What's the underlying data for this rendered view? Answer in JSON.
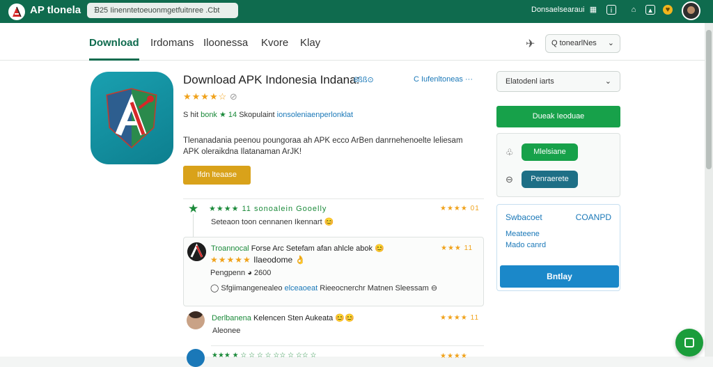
{
  "topbar": {
    "brand": "AP tlonela",
    "url": "ᗿ25 Iinenntetoeuonmgetfuitnree .Cbt",
    "user": "Donsaelsearaui",
    "icons": [
      "grid-icon",
      "info-icon",
      "home-icon",
      "image-icon",
      "coin-icon"
    ]
  },
  "nav": {
    "tabs": [
      "Download",
      "Irdomans",
      "Iloonessa",
      "Kvore",
      "Klay"
    ],
    "active_tab": "Download",
    "search_label": "Q tonearlNes"
  },
  "app": {
    "title": "Download APK Indonesia Indana:",
    "title_tag": "6ßß⊙",
    "title_action": "C Iufenltoneas ···",
    "rating_stars": "★★★★☆",
    "rating_extra": "⊘",
    "meta_prefix": "S hit",
    "meta_green": "bonk ★ 14",
    "meta_mid": "Skopulaint",
    "meta_blue": "ionsoleniaenperlonklat",
    "description": "Tlenanadania peenou poungoraa ah APK ecco ArBen danrnehenoelte leliesam APK oleraikdna Ilatanaman ArJK!",
    "button": "Ifdn lteaase"
  },
  "reviews": [
    {
      "head": "★★★★ 11 sonoalein Gooelly",
      "text": "Seteaon toon cennanen Ikennart 😊",
      "rating": "★★★★ 01"
    },
    {
      "head_green": "Troannocal",
      "head_rest": "Forse Arc Setefam afan ahlcle abok 😊",
      "stars": "★★★★★",
      "stars_text": "Ilaeodome 👌",
      "line1": "Pengpenn ◕ 2600",
      "line2_a": "◯ Sfgiimangenealeo",
      "line2_blue": "elceaoeat",
      "line2_b": "Rieeocnerchr Matnen Sleessam ⊖",
      "rating": "★★★ 11"
    },
    {
      "head_green": "Derlbanena",
      "head_rest": "Kelencen Sten Aukeata 😊😊",
      "sub": "Aleonee",
      "rating": "★★★★ 11"
    },
    {
      "head": "★★★ ★ ☆ ☆ ☆ ☆ ☆☆ ☆ ☆☆ ☆",
      "rating": "★★★★"
    }
  ],
  "sidebar": {
    "select_label": "Elatodenl iarts",
    "green_button": "Dueak Ieoduae",
    "pill_green": "Mlelsiane",
    "pill_teal": "Penraerete",
    "panel_title": "Swbacoet",
    "panel_right": "COANPD",
    "panel_line1": "Meateene",
    "panel_line2": "Mado canrd",
    "blue_button": "Bntlay"
  },
  "colors": {
    "topbar": "#0f6b4e",
    "accent_green": "#17a14a",
    "accent_blue": "#1b88c9",
    "teal": "#1e6f86",
    "star": "#f0a21b",
    "yellow_button": "#d9a21a"
  }
}
